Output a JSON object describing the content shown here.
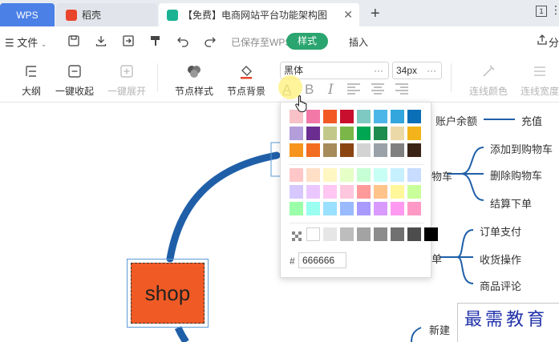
{
  "tabs": {
    "wps": "WPS",
    "daoke": "稻壳",
    "doc": "【免费】电商网站平台功能架构图",
    "close": "✕",
    "add": "+",
    "window_count": "1"
  },
  "menubar": {
    "file": "文件",
    "saved": "已保存至WPS",
    "style_tab": "样式",
    "insert_tab": "插入",
    "share": "分"
  },
  "toolbar": {
    "outline": "大纲",
    "collapse_all": "一键收起",
    "expand_all": "一键展开",
    "node_style": "节点样式",
    "node_bg": "节点背景",
    "font_family": "黑体",
    "font_size": "34px",
    "dots": "···",
    "font_color": "A",
    "bold": "B",
    "italic": "I",
    "line_color": "连线颜色",
    "line_width": "连线宽度"
  },
  "color_popup": {
    "hash": "#",
    "hex_value": "666666",
    "rows_theme": [
      [
        "#f8c1c8",
        "#f178a7",
        "#f15a24",
        "#c8102e",
        "#7ecac3",
        "#4db6e8",
        "#32a6dd",
        "#0b6fb8"
      ],
      [
        "#b39ddb",
        "#6b2e90",
        "#c2c88a",
        "#7ab648",
        "#00a651",
        "#1e8c4e",
        "#ecd9a8",
        "#f2b41a"
      ],
      [
        "#f7941d",
        "#f26d21",
        "#a68b5b",
        "#8b4513",
        "#d3d3d3",
        "#9aa1a8",
        "#808080",
        "#3a2416"
      ]
    ],
    "rows_light": [
      [
        "#ffc7c7",
        "#ffe0c7",
        "#fff7c2",
        "#e6ffc7",
        "#c7ffd4",
        "#c7fff5",
        "#c7f0ff",
        "#c7dcff"
      ],
      [
        "#d6c7ff",
        "#ebc7ff",
        "#ffc7f2",
        "#ffc7dd",
        "#ff9a9a",
        "#ffc48a",
        "#fff79a",
        "#c9ff9a"
      ],
      [
        "#9affa8",
        "#9afff0",
        "#9ae0ff",
        "#9abaff",
        "#a89aff",
        "#d99aff",
        "#ff9af0",
        "#ff9ac6"
      ]
    ],
    "row_gray": [
      "#ffffff",
      "#e6e6e6",
      "#bdbdbd",
      "#a3a3a3",
      "#8c8c8c",
      "#707070",
      "#4d4d4d",
      "#000000"
    ]
  },
  "mindmap": {
    "root": "shop",
    "labels": {
      "account_balance": "账户余额",
      "recharge": "充值",
      "cart_partial": "物车",
      "add_to_cart": "添加到购物车",
      "remove_from_cart": "删除购物车",
      "checkout": "结算下单",
      "order_partial": "单",
      "order_pay": "订单支付",
      "receipt": "收货操作",
      "review": "商品评论",
      "new": "新建"
    }
  },
  "watermark": "最需教育",
  "colors": {
    "accent_green": "#2aa56f",
    "wps_blue": "#4b80e6",
    "branch_blue": "#1f5fa8",
    "root_orange": "#f05a24"
  }
}
